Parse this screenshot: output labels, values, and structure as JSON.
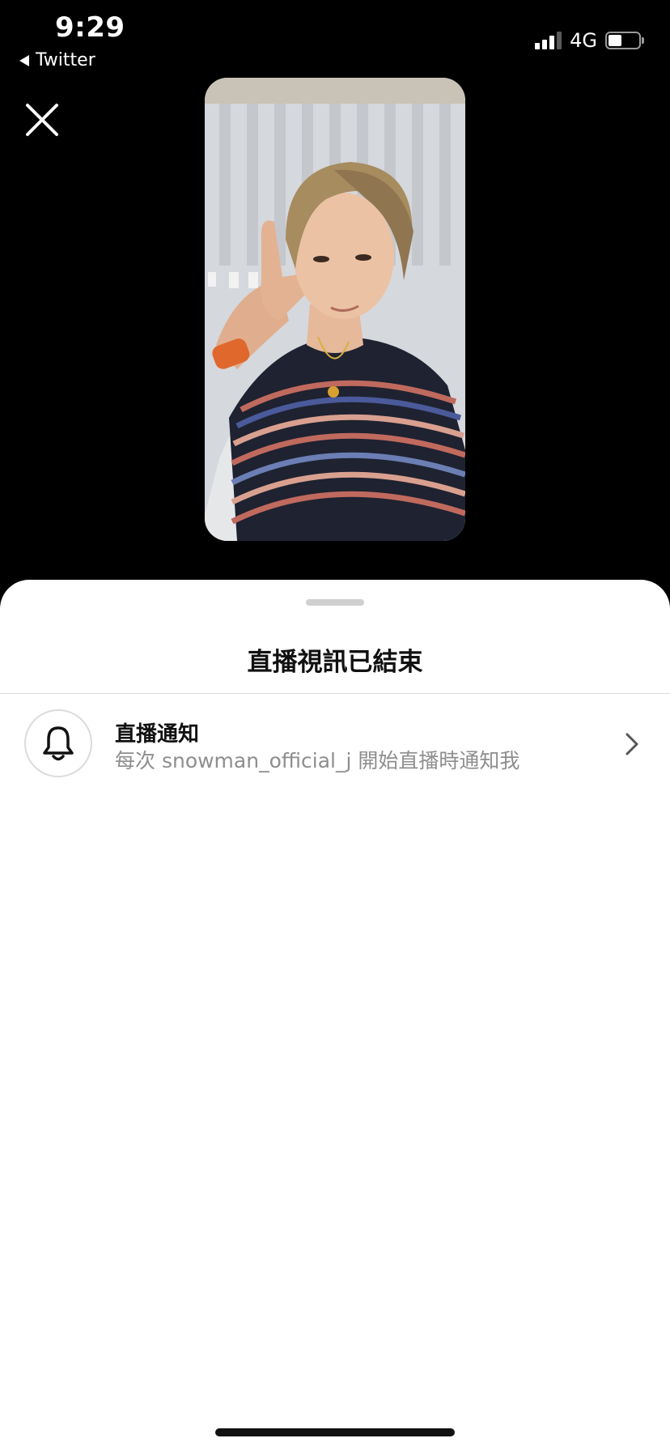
{
  "status_bar": {
    "time": "9:29",
    "back_app": "Twitter",
    "network": "4G",
    "battery_level": 0.45,
    "signal_bars_active": 3
  },
  "close_icon": "close-icon",
  "video": {
    "state": "ended"
  },
  "sheet": {
    "title": "直播視訊已結束",
    "notification": {
      "icon": "bell-icon",
      "title": "直播通知",
      "subtitle": "每次 snowman_official_j 開始直播時通知我"
    }
  }
}
